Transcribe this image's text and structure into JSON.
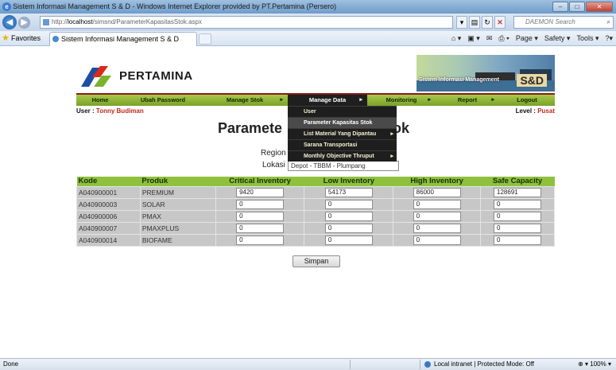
{
  "window": {
    "title": "Sistem Informasi Management S & D - Windows Internet Explorer provided by PT.Pertamina (Persero)",
    "min": "–",
    "max": "□",
    "close": "✕"
  },
  "address": {
    "url_prefix": "http://",
    "url_host": "localhost",
    "url_path": "/simsnd/ParameterKapasitasStok.aspx",
    "search_placeholder": "DAEMON Search"
  },
  "favorites": {
    "label": "Favorites",
    "tab_title": "Sistem Informasi Management S & D",
    "commands": [
      "Page ▾",
      "Safety ▾",
      "Tools ▾"
    ]
  },
  "brand": {
    "logo_text": "PERTAMINA",
    "banner_text": "Sistem Informasi Management",
    "banner_badge": "S&D"
  },
  "menu": {
    "items": [
      "Home",
      "Ubah Password",
      "Manage Stok",
      "Manage Data",
      "Monitoring",
      "Report",
      "Logout"
    ],
    "dropdown": [
      "User",
      "Parameter Kapasitas Stok",
      "List Material Yang Dipantau",
      "Sarana Transportasi",
      "Monthly Objective Thruput"
    ]
  },
  "user": {
    "label": "User : ",
    "name": "Tonny Budiman"
  },
  "level": {
    "label": "Level : ",
    "value": "Pusat"
  },
  "page": {
    "heading_left": "Paramete",
    "heading_right": "ok",
    "region_label": "Region",
    "lokasi_label": "Lokasi",
    "lokasi_value": "Depot - TBBM - Plumpang",
    "save_label": "Simpan"
  },
  "table": {
    "headers": [
      "Kode",
      "Produk",
      "Critical Inventory",
      "Low Inventory",
      "High Inventory",
      "Safe Capacity"
    ],
    "rows": [
      {
        "kode": "A040900001",
        "produk": "PREMIUM",
        "critical": "9420",
        "low": "54173",
        "high": "86000",
        "safe": "128691"
      },
      {
        "kode": "A040900003",
        "produk": "SOLAR",
        "critical": "0",
        "low": "0",
        "high": "0",
        "safe": "0"
      },
      {
        "kode": "A040900006",
        "produk": "PMAX",
        "critical": "0",
        "low": "0",
        "high": "0",
        "safe": "0"
      },
      {
        "kode": "A040900007",
        "produk": "PMAXPLUS",
        "critical": "0",
        "low": "0",
        "high": "0",
        "safe": "0"
      },
      {
        "kode": "A040900014",
        "produk": "BIOFAME",
        "critical": "0",
        "low": "0",
        "high": "0",
        "safe": "0"
      }
    ]
  },
  "status": {
    "left": "Done",
    "zone": "Local intranet | Protected Mode: Off",
    "zoom": "100%"
  }
}
